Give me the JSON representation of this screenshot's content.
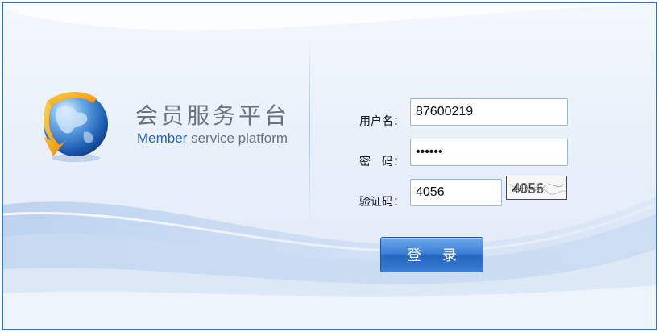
{
  "branding": {
    "title_cn": "会员服务平台",
    "title_en_highlight": "Member",
    "title_en_rest": " service platform"
  },
  "form": {
    "username_label": "用户名：",
    "username_value": "87600219",
    "password_label": "密　码：",
    "password_value": "123456",
    "captcha_label": "验证码：",
    "captcha_value": "4056",
    "captcha_image_text": "4056",
    "login_label": "登 录"
  },
  "colors": {
    "border": "#3a72c0",
    "accent": "#2a66b3",
    "button": "#2f72c8"
  }
}
